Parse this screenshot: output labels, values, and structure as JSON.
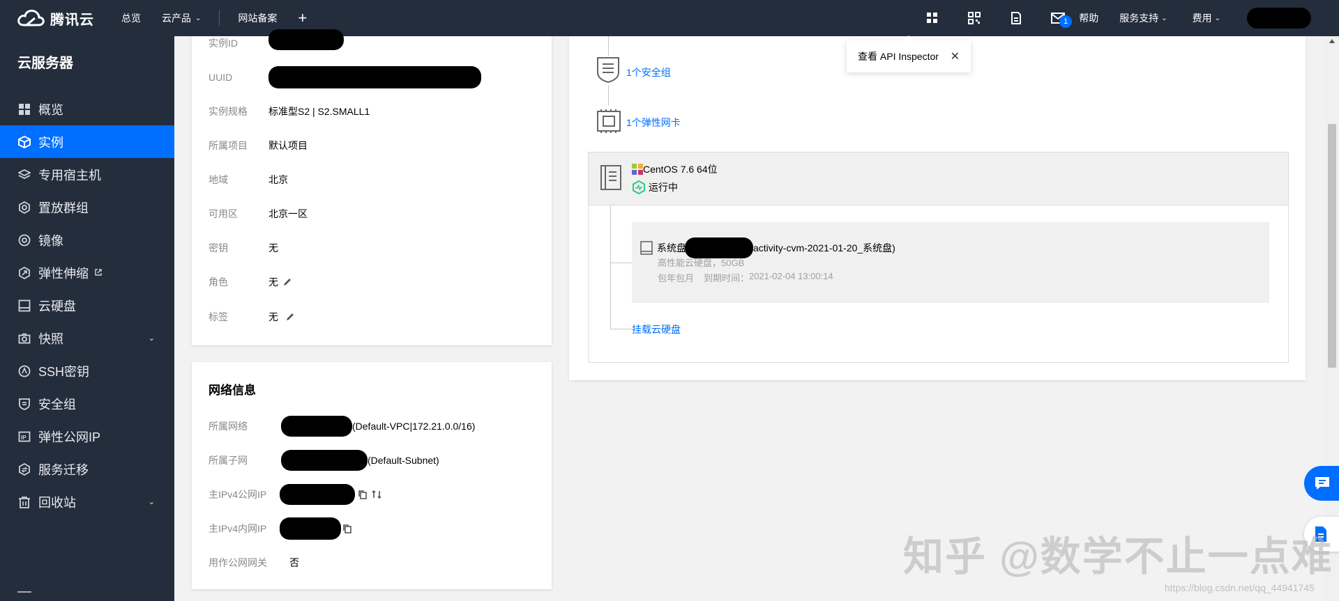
{
  "topbar": {
    "brand": "腾讯云",
    "nav": [
      "总览",
      "云产品",
      "网站备案"
    ],
    "mail_badge": "1",
    "help": "帮助",
    "service": "服务支持",
    "fees": "费用"
  },
  "sidebar": {
    "title": "云服务器",
    "items": [
      {
        "label": "概览",
        "icon": "grid-icon"
      },
      {
        "label": "实例",
        "icon": "cube-icon",
        "active": true
      },
      {
        "label": "专用宿主机",
        "icon": "layers-icon"
      },
      {
        "label": "置放群组",
        "icon": "hex-group-icon"
      },
      {
        "label": "镜像",
        "icon": "disc-icon"
      },
      {
        "label": "弹性伸缩",
        "icon": "scale-icon",
        "external": true
      },
      {
        "label": "云硬盘",
        "icon": "disk-icon"
      },
      {
        "label": "快照",
        "icon": "camera-icon",
        "expandable": true
      },
      {
        "label": "SSH密钥",
        "icon": "key-icon"
      },
      {
        "label": "安全组",
        "icon": "shield-icon"
      },
      {
        "label": "弹性公网IP",
        "icon": "ip-icon"
      },
      {
        "label": "服务迁移",
        "icon": "migrate-icon"
      },
      {
        "label": "回收站",
        "icon": "trash-icon",
        "expandable": true
      }
    ]
  },
  "basic_info": {
    "instance_id_label": "实例ID",
    "uuid_label": "UUID",
    "spec_label": "实例规格",
    "spec_value": "标准型S2 | S2.SMALL1",
    "project_label": "所属项目",
    "project_value": "默认项目",
    "region_label": "地域",
    "region_value": "北京",
    "zone_label": "可用区",
    "zone_value": "北京一区",
    "key_label": "密钥",
    "key_value": "无",
    "role_label": "角色",
    "role_value": "无",
    "tag_label": "标签",
    "tag_value": "无"
  },
  "network_info": {
    "title": "网络信息",
    "vpc_label": "所属网络",
    "vpc_value": "(Default-VPC|172.21.0.0/16)",
    "subnet_label": "所属子网",
    "subnet_value": "(Default-Subnet)",
    "public_ip_label": "主IPv4公网IP",
    "private_ip_label": "主IPv4内网IP",
    "gateway_label": "用作公网网关",
    "gateway_value": "否"
  },
  "topology": {
    "security_group": "1个安全组",
    "eni": "1个弹性网卡",
    "os": "CentOS 7.6 64位",
    "status": "运行中",
    "disk_prefix": "系统盘",
    "disk_name": "activity-cvm-2021-01-20_系统盘)",
    "disk_type": "高性能云硬盘，50GB",
    "billing": "包年包月",
    "expire_label": "到期时间：",
    "expire_value": "2021-02-04 13:00:14",
    "mount_link": "挂载云硬盘"
  },
  "tooltip": {
    "text": "查看 API Inspector"
  },
  "watermark": {
    "text": "知乎 @数学不止一点难",
    "url": "https://blog.csdn.net/qq_44941745"
  },
  "colors": {
    "topbar": "#242d3c",
    "accent": "#006eff",
    "status_green": "#29cc85"
  }
}
